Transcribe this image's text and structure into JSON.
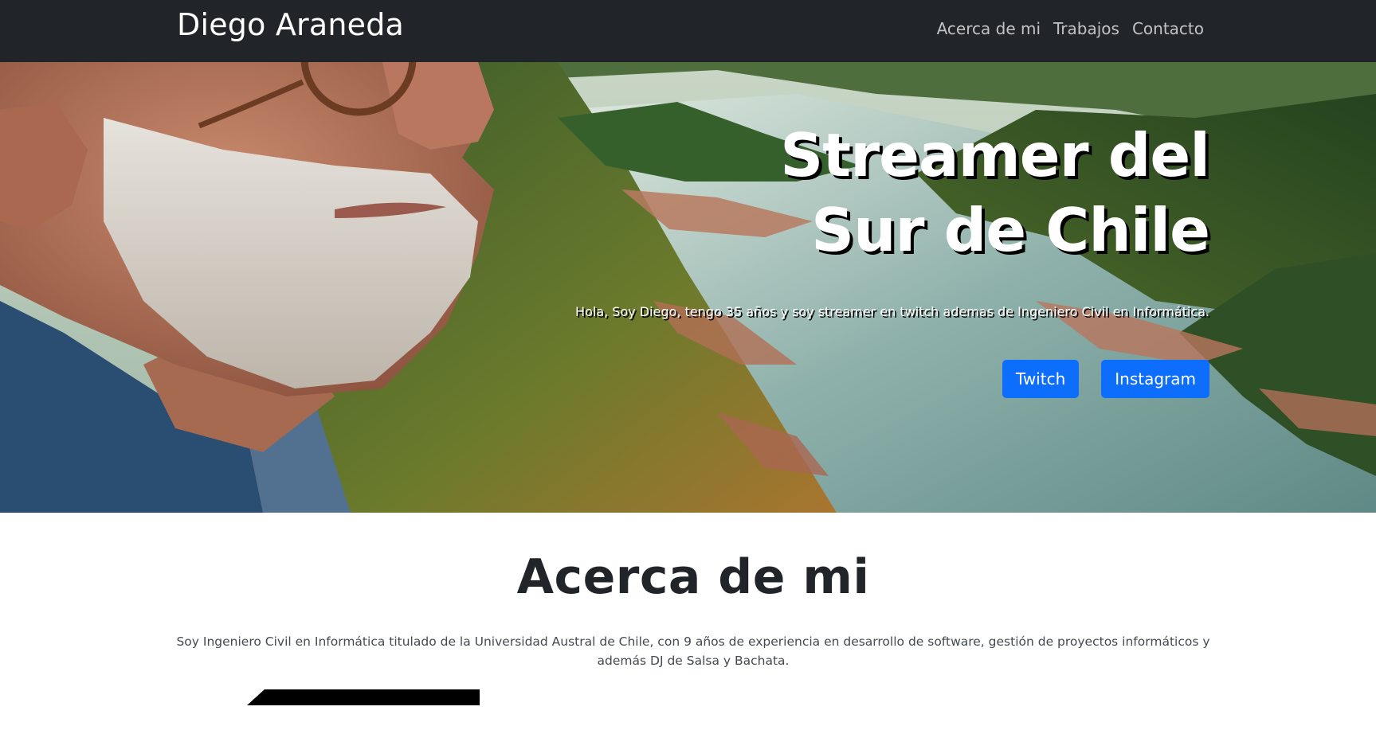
{
  "navbar": {
    "brand": "Diego Araneda",
    "links": [
      "Acerca de mi",
      "Trabajos",
      "Contacto"
    ]
  },
  "hero": {
    "title_line1": "Streamer del",
    "title_line2": "Sur de Chile",
    "subtitle": "Hola, Soy Diego, tengo 35 años y soy streamer en twitch ademas de Ingeniero Civil en Informática.",
    "buttons": {
      "twitch": "Twitch",
      "instagram": "Instagram"
    },
    "background_image": "portrait-landscape-image"
  },
  "about": {
    "title": "Acerca de mi",
    "text": "Soy Ingeniero Civil en Informática titulado de la Universidad Austral de Chile, con 9 años de experiencia en desarrollo de software, gestión de proyectos informáticos y además DJ de Salsa y Bachata."
  },
  "colors": {
    "navbar_bg": "#212529",
    "button_bg": "#0d6efd",
    "heading_text": "#212529"
  }
}
